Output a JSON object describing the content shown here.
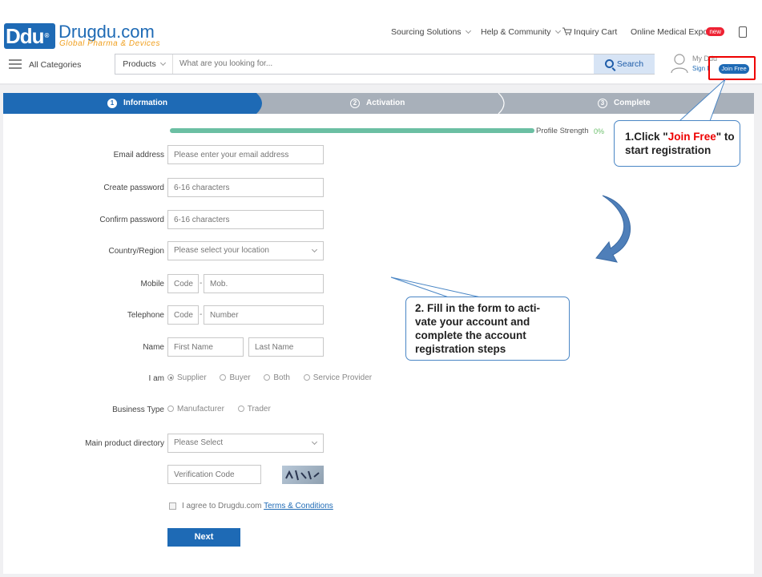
{
  "header": {
    "logo_text": "Ddu",
    "logo_name": "Drugdu.com",
    "logo_tagline": "Global Pharma & Devices",
    "nav": [
      "Sourcing Solutions",
      "Help & Community",
      "Inquiry Cart",
      "Online Medical Expo"
    ],
    "nav_badge": "new",
    "all_categories": "All Categories",
    "search_scope": "Products",
    "search_placeholder": "What are you looking for...",
    "search_button": "Search",
    "my_account": "My Ddu",
    "sign_in": "Sign I",
    "join_free": "Join Free"
  },
  "steps": [
    {
      "num": "1",
      "label": "Information"
    },
    {
      "num": "2",
      "label": "Activation"
    },
    {
      "num": "3",
      "label": "Complete"
    }
  ],
  "form": {
    "profile_strength_label": "Profile Strength",
    "profile_strength_value": "0%",
    "profile_strength_progress": 0,
    "email_label": "Email address",
    "email_placeholder": "Please enter your email address",
    "password_label": "Create password",
    "password_placeholder": "6-16 characters",
    "confirm_label": "Confirm password",
    "confirm_placeholder": "6-16 characters",
    "country_label": "Country/Region",
    "country_value": "Please select your location",
    "mobile_label": "Mobile",
    "mobile_code": "Code",
    "mobile_placeholder": "Mob.",
    "telephone_label": "Telephone",
    "telephone_code": "Code",
    "telephone_placeholder": "Number",
    "name_label": "Name",
    "first_name_placeholder": "First Name",
    "last_name_placeholder": "Last Name",
    "iam_label": "I am",
    "iam_options": [
      "Supplier",
      "Buyer",
      "Both",
      "Service Provider"
    ],
    "business_label": "Business Type",
    "business_options": [
      "Manufacturer",
      "Trader"
    ],
    "directory_label": "Main product directory",
    "directory_value": "Please Select",
    "verification_placeholder": "Verification Code",
    "agree_text": "I agree to Drugdu.com",
    "terms_link": "Terms & Conditions",
    "next_button": "Next",
    "dash": "-"
  },
  "callouts": {
    "c1_prefix": "1.Click \"",
    "c1_highlight": "Join Free",
    "c1_suffix_line1": "\" to",
    "c1_line2": "start registration",
    "c2_lines": [
      "2. Fill in the form to acti-",
      "vate your account and",
      "complete the account",
      "registration steps"
    ]
  },
  "colors": {
    "brand_blue": "#1e6ab5",
    "step_inactive": "#a8b0ba",
    "progress_green": "#6bbfa3",
    "callout_red": "#e00000"
  }
}
